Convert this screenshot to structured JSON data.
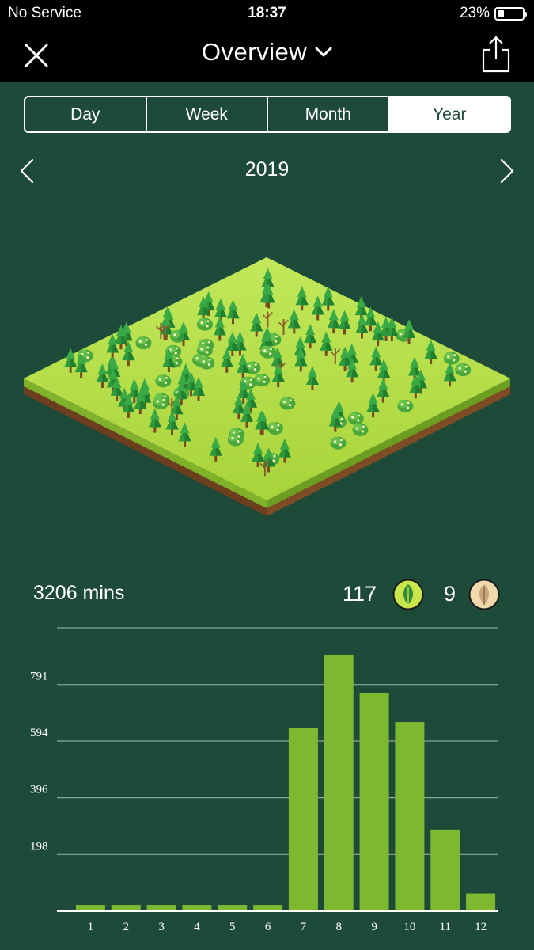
{
  "status_bar": {
    "carrier": "No Service",
    "time": "18:37",
    "battery": "23%"
  },
  "nav": {
    "title": "Overview",
    "close_icon": "close-icon",
    "dropdown_icon": "chevron-down-icon",
    "share_icon": "share-icon"
  },
  "segments": [
    {
      "label": "Day",
      "active": false
    },
    {
      "label": "Week",
      "active": false
    },
    {
      "label": "Month",
      "active": false
    },
    {
      "label": "Year",
      "active": true
    }
  ],
  "period": {
    "label": "2019",
    "prev_icon": "chevron-left-icon",
    "next_icon": "chevron-right-icon"
  },
  "stats": {
    "total_time": "3206 mins",
    "healthy_trees": "117",
    "dead_trees": "9"
  },
  "colors": {
    "background": "#1e4a3a",
    "bar": "#7cb830",
    "bar_dark": "#5a9124",
    "grass": "#b7e04a",
    "soil": "#8b5a2b"
  },
  "chart_data": {
    "type": "bar",
    "categories": [
      "1",
      "2",
      "3",
      "4",
      "5",
      "6",
      "7",
      "8",
      "9",
      "10",
      "11",
      "12"
    ],
    "values": [
      22,
      22,
      22,
      22,
      22,
      22,
      640,
      895,
      762,
      660,
      285,
      62
    ],
    "y_ticks": [
      "198",
      "396",
      "594",
      "791"
    ],
    "y_tick_values": [
      198,
      396,
      594,
      791
    ],
    "ylim": [
      0,
      989
    ],
    "grid": true,
    "title": "",
    "xlabel": "",
    "ylabel": ""
  }
}
